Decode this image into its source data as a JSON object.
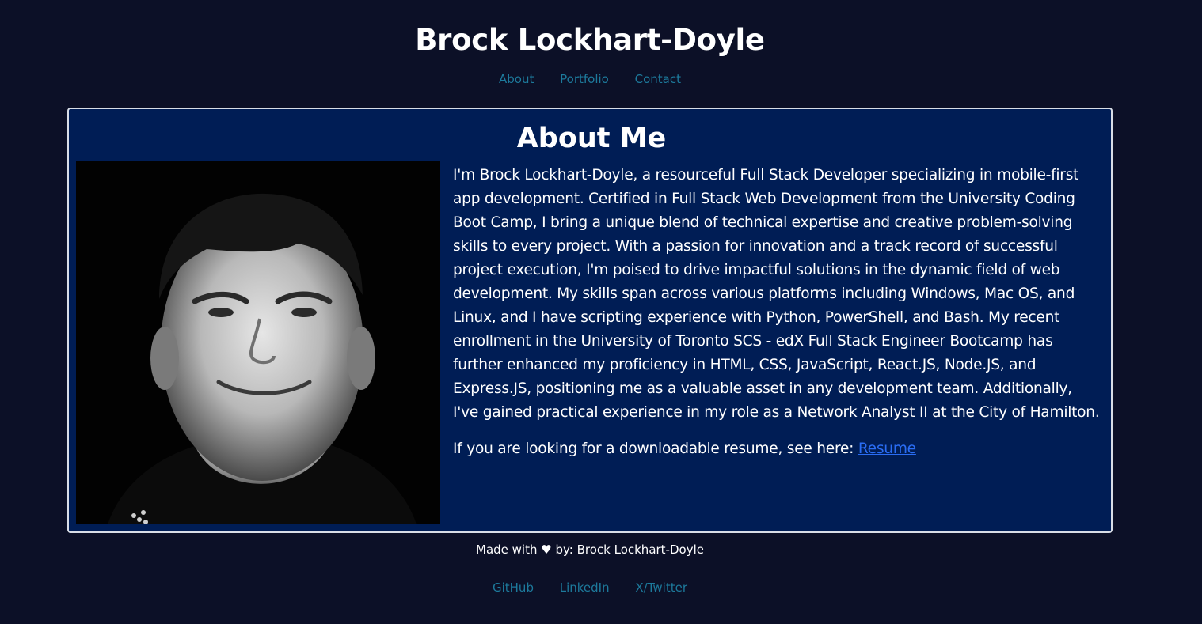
{
  "header": {
    "title": "Brock Lockhart-Doyle",
    "nav": [
      "About",
      "Portfolio",
      "Contact"
    ]
  },
  "about": {
    "heading": "About Me",
    "photo_alt": "portrait photo",
    "bio": "I'm Brock Lockhart-Doyle, a resourceful Full Stack Developer specializing in mobile-first app development. Certified in Full Stack Web Development from the University Coding Boot Camp, I bring a unique blend of technical expertise and creative problem-solving skills to every project. With a passion for innovation and a track record of successful project execution, I'm poised to drive impactful solutions in the dynamic field of web development. My skills span across various platforms including Windows, Mac OS, and Linux, and I have scripting experience with Python, PowerShell, and Bash. My recent enrollment in the University of Toronto SCS - edX Full Stack Engineer Bootcamp has further enhanced my proficiency in HTML, CSS, JavaScript, React.JS, Node.JS, and Express.JS, positioning me as a valuable asset in any development team. Additionally, I've gained practical experience in my role as a Network Analyst II at the City of Hamilton.",
    "resume_prefix": "If you are looking for a downloadable resume, see here: ",
    "resume_link": "Resume"
  },
  "footer": {
    "credit_prefix": "Made with ",
    "heart": "♥",
    "credit_suffix": " by: Brock Lockhart-Doyle",
    "links": [
      "GitHub",
      "LinkedIn",
      "X/Twitter"
    ]
  },
  "colors": {
    "background": "#0c1027",
    "card": "#001d55",
    "nav_link": "#1d7a9c",
    "resume_link": "#2a6df4"
  }
}
